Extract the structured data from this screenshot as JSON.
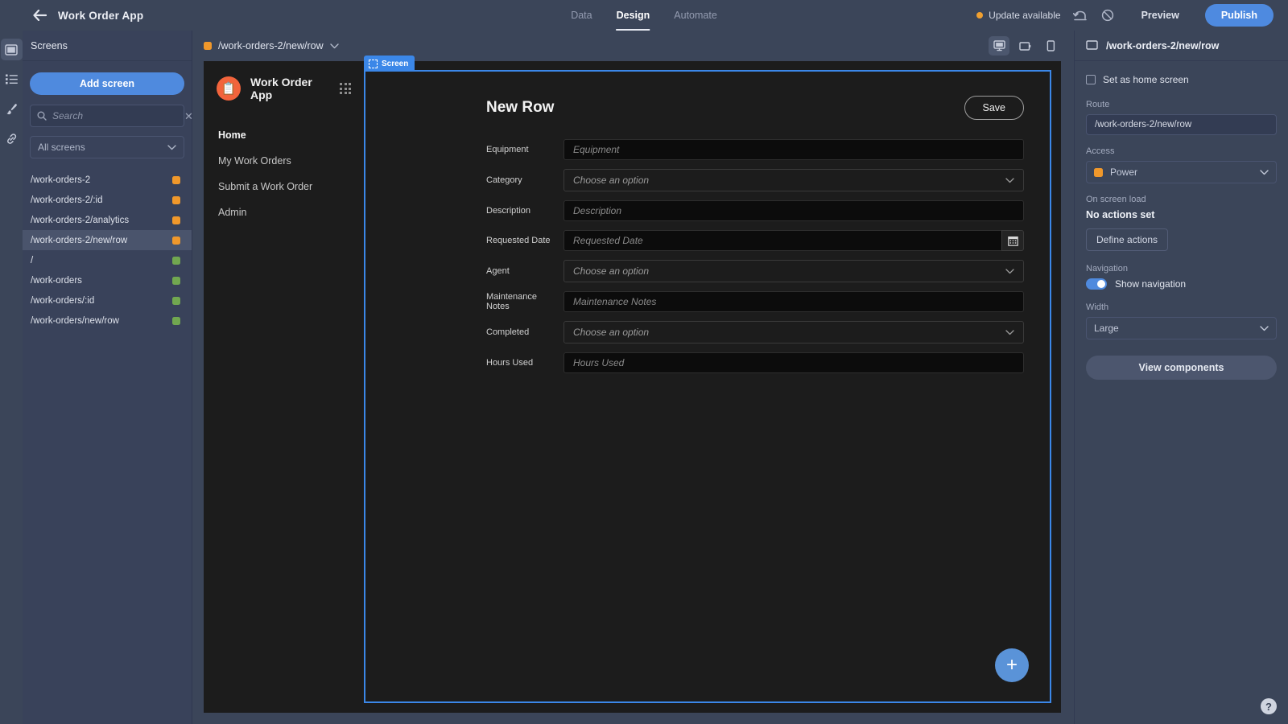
{
  "topbar": {
    "back_icon": "back-arrow-icon",
    "app_title": "Work Order App",
    "tabs": [
      {
        "label": "Data",
        "active": false
      },
      {
        "label": "Design",
        "active": true
      },
      {
        "label": "Automate",
        "active": false
      }
    ],
    "update_text": "Update available",
    "update_dot_color": "#f0a030",
    "undo_icon": "undo-icon",
    "disabled_icon": "redo-disabled-icon",
    "preview_label": "Preview",
    "publish_label": "Publish",
    "publish_color": "#4e8ae0"
  },
  "rail": {
    "items": [
      {
        "name": "screens-icon",
        "active": true
      },
      {
        "name": "components-list-icon",
        "active": false
      },
      {
        "name": "theme-brush-icon",
        "active": false
      },
      {
        "name": "links-icon",
        "active": false
      }
    ]
  },
  "screens_panel": {
    "heading": "Screens",
    "add_screen_label": "Add screen",
    "search_placeholder": "Search",
    "search_value": "",
    "clear_icon": "close-icon",
    "filter_value": "All screens",
    "screens": [
      {
        "route": "/work-orders-2",
        "color": "#f0982b",
        "selected": false
      },
      {
        "route": "/work-orders-2/:id",
        "color": "#f0982b",
        "selected": false
      },
      {
        "route": "/work-orders-2/analytics",
        "color": "#f0982b",
        "selected": false
      },
      {
        "route": "/work-orders-2/new/row",
        "color": "#f0982b",
        "selected": true
      },
      {
        "route": "/",
        "color": "#71a750",
        "selected": false
      },
      {
        "route": "/work-orders",
        "color": "#71a750",
        "selected": false
      },
      {
        "route": "/work-orders/:id",
        "color": "#71a750",
        "selected": false
      },
      {
        "route": "/work-orders/new/row",
        "color": "#71a750",
        "selected": false
      }
    ]
  },
  "canvas": {
    "route_label": "/work-orders-2/new/row",
    "route_dot_color": "#f0982b",
    "devices": [
      {
        "name": "desktop-view-icon",
        "active": true
      },
      {
        "name": "tablet-view-icon",
        "active": false
      },
      {
        "name": "mobile-view-icon",
        "active": false
      }
    ],
    "screen_badge": "Screen",
    "badge_color": "#3b87e8"
  },
  "preview_app": {
    "brand_name": "Work Order App",
    "logo_icon": "clipboard-icon",
    "logo_color": "#f2643c",
    "apps_grid_icon": "apps-grid-icon",
    "nav_links": [
      {
        "label": "Home",
        "active": true
      },
      {
        "label": "My Work Orders",
        "active": false
      },
      {
        "label": "Submit a Work Order",
        "active": false
      },
      {
        "label": "Admin",
        "active": false
      }
    ],
    "form_title": "New Row",
    "save_label": "Save",
    "fields": [
      {
        "label": "Equipment",
        "type": "text",
        "placeholder": "Equipment",
        "value": ""
      },
      {
        "label": "Category",
        "type": "select",
        "placeholder": "Choose an option",
        "value": ""
      },
      {
        "label": "Description",
        "type": "text",
        "placeholder": "Description",
        "value": ""
      },
      {
        "label": "Requested Date",
        "type": "date",
        "placeholder": "Requested Date",
        "value": ""
      },
      {
        "label": "Agent",
        "type": "select",
        "placeholder": "Choose an option",
        "value": ""
      },
      {
        "label": "Maintenance Notes",
        "type": "text",
        "placeholder": "Maintenance Notes",
        "value": ""
      },
      {
        "label": "Completed",
        "type": "select",
        "placeholder": "Choose an option",
        "value": ""
      },
      {
        "label": "Hours Used",
        "type": "text",
        "placeholder": "Hours Used",
        "value": ""
      }
    ],
    "fab_label": "+",
    "fab_color": "#5a93d8"
  },
  "right_panel": {
    "title": "/work-orders-2/new/row",
    "title_icon": "screen-icon",
    "home_checkbox_label": "Set as home screen",
    "home_checked": false,
    "route_label": "Route",
    "route_value": "/work-orders-2/new/row",
    "access_label": "Access",
    "access_value": "Power",
    "access_dot_color": "#f0982b",
    "on_load_label": "On screen load",
    "on_load_value": "No actions set",
    "define_actions_label": "Define actions",
    "navigation_label": "Navigation",
    "show_navigation_label": "Show navigation",
    "show_navigation_on": true,
    "width_label": "Width",
    "width_value": "Large",
    "view_components_label": "View components"
  },
  "help": {
    "label": "?"
  }
}
